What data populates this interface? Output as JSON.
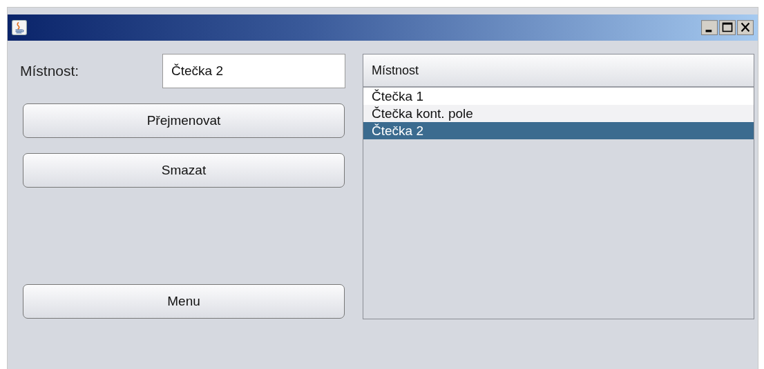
{
  "form": {
    "label": "Místnost:",
    "field_value": "Čtečka 2"
  },
  "buttons": [
    {
      "label": "Přejmenovat"
    },
    {
      "label": "Smazat"
    },
    {
      "label": "Menu"
    }
  ],
  "table": {
    "columns": [
      "Místnost"
    ],
    "rows": [
      {
        "cells": [
          "Čtečka 1"
        ],
        "selected": false
      },
      {
        "cells": [
          "Čtečka kont. pole"
        ],
        "selected": false
      },
      {
        "cells": [
          "Čtečka 2"
        ],
        "selected": true
      }
    ]
  }
}
